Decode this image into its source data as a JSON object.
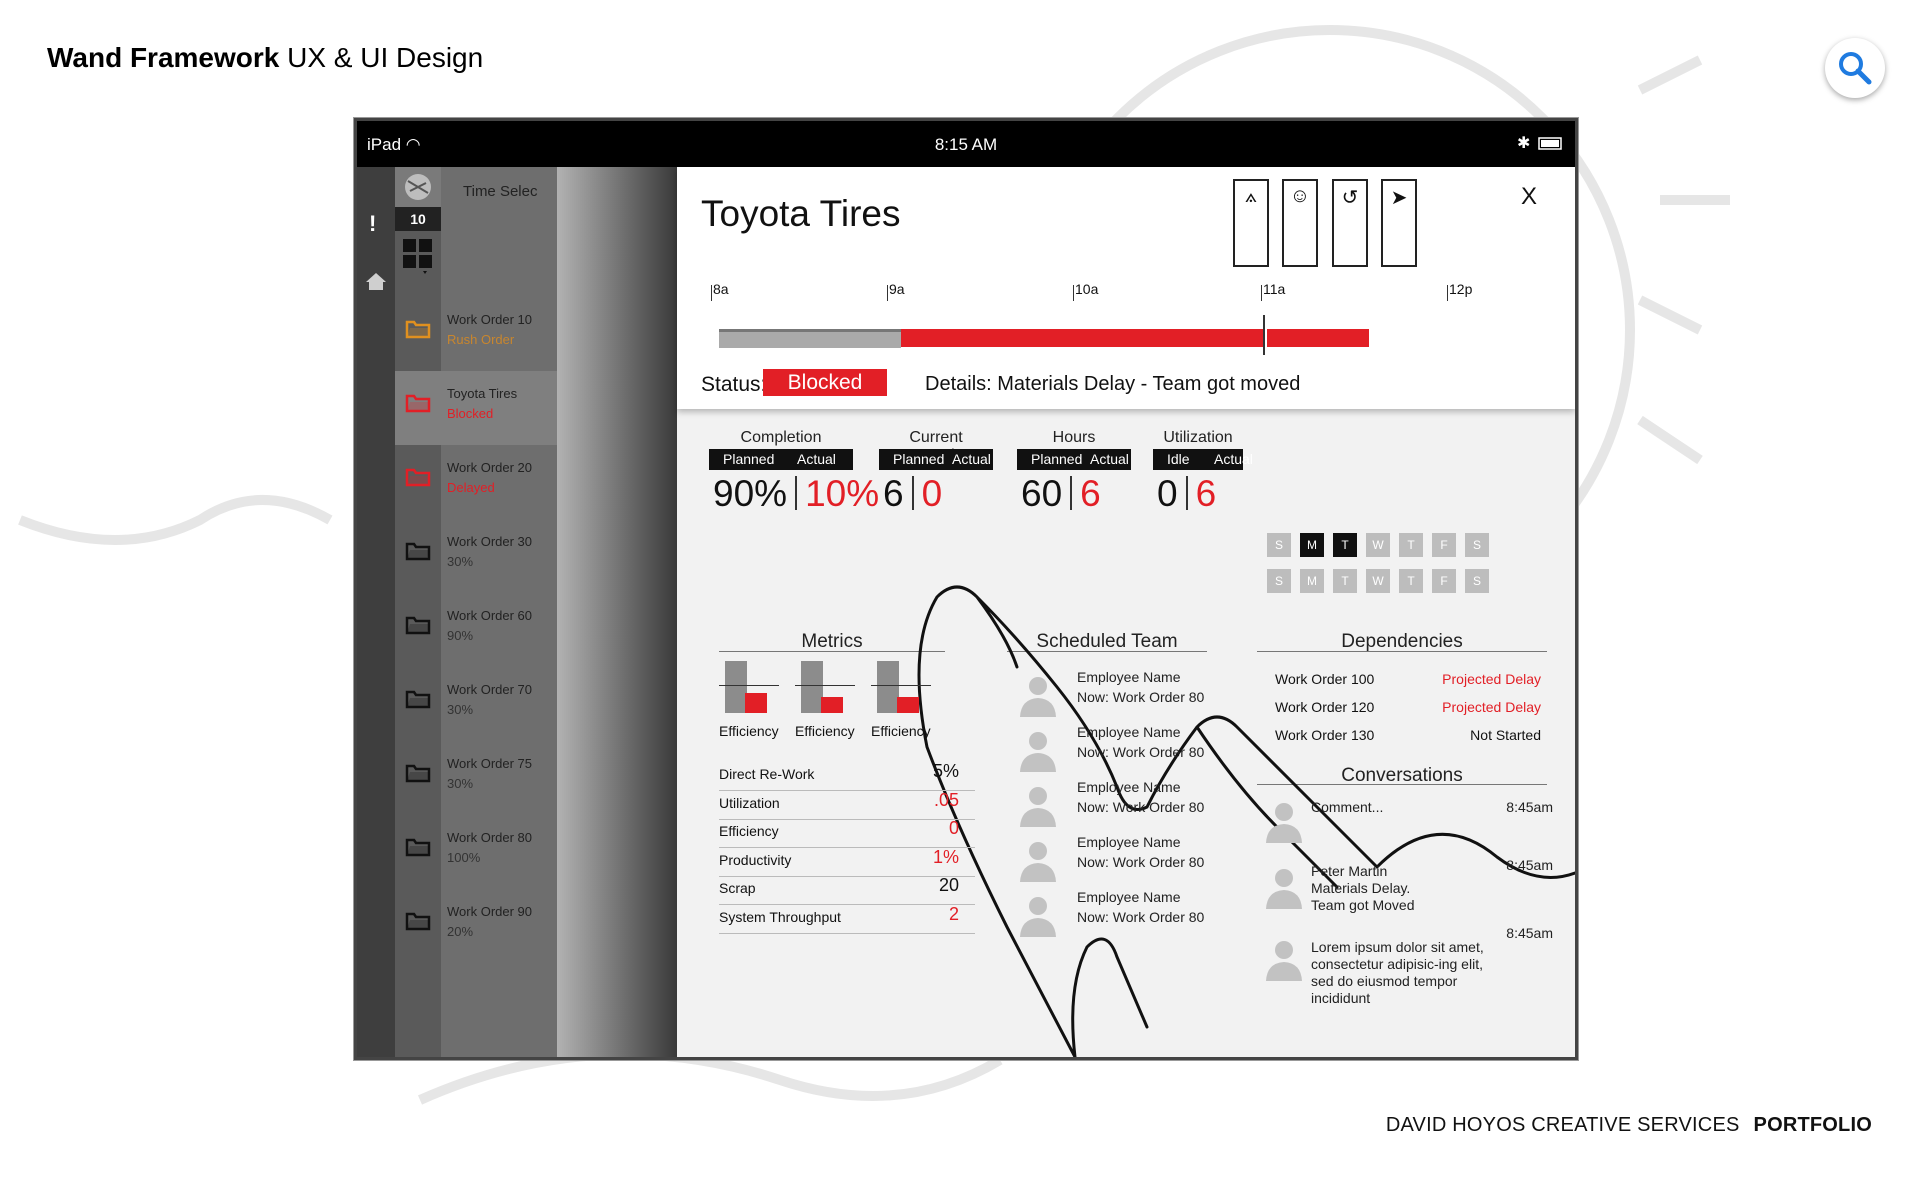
{
  "page": {
    "title_bold": "Wand Framework",
    "title_rest": " UX & UI Design",
    "footer_left": "DAVID HOYOS CREATIVE SERVICES",
    "footer_right": "PORTFOLIO"
  },
  "statusbar": {
    "device": "iPad",
    "time": "8:15 AM"
  },
  "rail": {
    "alert_count": "10"
  },
  "dim": {
    "time_select": "Time Selec"
  },
  "work_orders": [
    {
      "name": "Work Order 10",
      "status": "Rush Order",
      "status_color": "#c8862e",
      "icon_color": "#e0901f"
    },
    {
      "name": "Toyota Tires",
      "status": "Blocked",
      "status_color": "#e21f26",
      "icon_color": "#e21f26"
    },
    {
      "name": "Work Order 20",
      "status": "Delayed",
      "status_color": "#e21f26",
      "icon_color": "#e21f26"
    },
    {
      "name": "Work Order 30",
      "status": "30%",
      "status_color": "#333333",
      "icon_color": "#111111"
    },
    {
      "name": "Work Order 60",
      "status": "90%",
      "status_color": "#333333",
      "icon_color": "#111111"
    },
    {
      "name": "Work Order 70",
      "status": "30%",
      "status_color": "#333333",
      "icon_color": "#111111"
    },
    {
      "name": "Work Order 75",
      "status": "30%",
      "status_color": "#333333",
      "icon_color": "#111111"
    },
    {
      "name": "Work Order 80",
      "status": "100%",
      "status_color": "#333333",
      "icon_color": "#111111"
    },
    {
      "name": "Work Order 90",
      "status": "20%",
      "status_color": "#333333",
      "icon_color": "#111111"
    }
  ],
  "detail": {
    "title": "Toyota Tires",
    "close": "X",
    "tools": [
      "compass-icon",
      "team-icon",
      "link-icon",
      "bird-icon"
    ],
    "timeline_ticks": [
      "8a",
      "9a",
      "10a",
      "11a",
      "12p"
    ],
    "status_label": "Status:",
    "status_value": "Blocked",
    "details_text": "Details: Materials Delay  - Team got moved"
  },
  "stats": [
    {
      "title": "Completion",
      "sub_a": "Planned",
      "sub_b": "Actual",
      "a": "90%",
      "b": "10%"
    },
    {
      "title": "Current Capacity",
      "sub_a": "Planned",
      "sub_b": "Actual",
      "a": "6",
      "b": "0"
    },
    {
      "title": "Hours",
      "sub_a": "Planned",
      "sub_b": "Actual",
      "a": "60",
      "b": "6"
    },
    {
      "title": "Utilization",
      "sub_a": "Idle",
      "sub_b": "Actual",
      "a": "0",
      "b": "6"
    }
  ],
  "days_row1": [
    {
      "d": "S",
      "on": false
    },
    {
      "d": "M",
      "on": true
    },
    {
      "d": "T",
      "on": true
    },
    {
      "d": "W",
      "on": false
    },
    {
      "d": "T",
      "on": false
    },
    {
      "d": "F",
      "on": false
    },
    {
      "d": "S",
      "on": false
    }
  ],
  "days_row2": [
    {
      "d": "S",
      "on": false
    },
    {
      "d": "M",
      "on": false
    },
    {
      "d": "T",
      "on": false
    },
    {
      "d": "W",
      "on": false
    },
    {
      "d": "T",
      "on": false
    },
    {
      "d": "F",
      "on": false
    },
    {
      "d": "S",
      "on": false
    }
  ],
  "metrics": {
    "title": "Metrics",
    "charts": [
      {
        "label": "Efficiency",
        "planned": 1.0,
        "actual": 0.38
      },
      {
        "label": "Efficiency",
        "planned": 1.0,
        "actual": 0.3
      },
      {
        "label": "Efficiency",
        "planned": 1.0,
        "actual": 0.3
      }
    ],
    "rows": [
      {
        "label": "Direct Re-Work",
        "value": "5%",
        "red": false
      },
      {
        "label": "Utilization",
        "value": ".05",
        "red": true
      },
      {
        "label": "Efficiency",
        "value": "0",
        "red": true
      },
      {
        "label": "Productivity",
        "value": "1%",
        "red": true
      },
      {
        "label": "Scrap",
        "value": "20",
        "red": false
      },
      {
        "label": "System Throughput",
        "value": "2",
        "red": true
      }
    ]
  },
  "team": {
    "title": "Scheduled Team",
    "members": [
      {
        "name": "Employee Name",
        "work": "Now: Work Order 80"
      },
      {
        "name": "Employee Name",
        "work": "Now: Work Order 80"
      },
      {
        "name": "Employee Name",
        "work": "Now: Work Order 80"
      },
      {
        "name": "Employee Name",
        "work": "Now: Work Order 80"
      },
      {
        "name": "Employee Name",
        "work": "Now: Work Order 80"
      }
    ]
  },
  "dependencies": {
    "title": "Dependencies",
    "items": [
      {
        "name": "Work Order 100",
        "status": "Projected Delay",
        "red": true
      },
      {
        "name": "Work Order 120",
        "status": "Projected Delay",
        "red": true
      },
      {
        "name": "Work Order 130",
        "status": "Not Started",
        "red": false
      }
    ]
  },
  "conversations": {
    "title": "Conversations",
    "items": [
      {
        "text": "Comment...",
        "time": "8:45am"
      },
      {
        "text": "Peter Martin\nMaterials Delay.\nTeam got Moved",
        "time": "8:45am"
      },
      {
        "text": "Lorem ipsum dolor sit amet, consectetur adipisic-ing elit, sed do eiusmod tempor incididunt",
        "time": "8:45am"
      }
    ]
  }
}
